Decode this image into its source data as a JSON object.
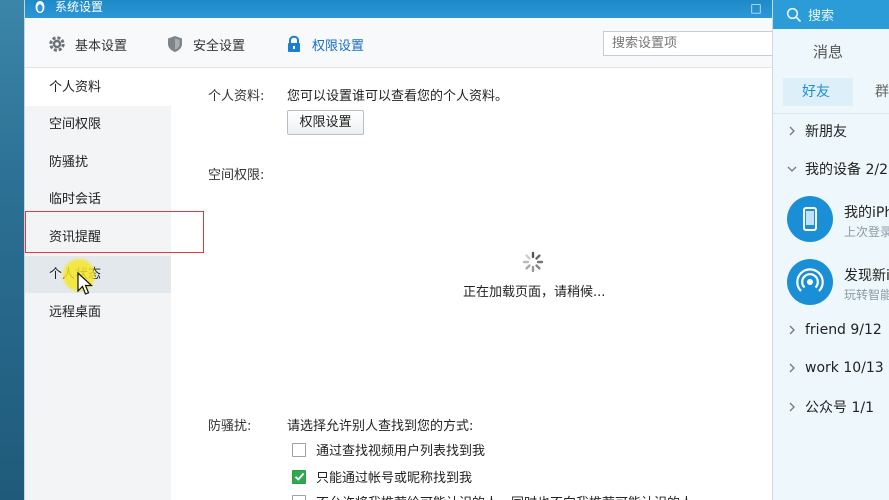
{
  "window": {
    "title": "系统设置",
    "close_glyph": "□"
  },
  "toolbar": {
    "items": [
      {
        "label": "基本设置",
        "icon": "gear-icon"
      },
      {
        "label": "安全设置",
        "icon": "shield-icon"
      },
      {
        "label": "权限设置",
        "icon": "lock-icon",
        "active": true
      }
    ],
    "search_placeholder": "搜索设置项"
  },
  "sidebar": {
    "items": [
      {
        "label": "个人资料"
      },
      {
        "label": "空间权限"
      },
      {
        "label": "防骚扰"
      },
      {
        "label": "临时会话"
      },
      {
        "label": "资讯提醒"
      },
      {
        "label": "个人状态"
      },
      {
        "label": "远程桌面"
      }
    ]
  },
  "content": {
    "profile_label": "个人资料:",
    "profile_text": "您可以设置谁可以查看您的个人资料。",
    "perm_button": "权限设置",
    "space_label": "空间权限:",
    "loading_text": "正在加载页面，请稍候...",
    "harass_label": "防骚扰:",
    "harass_text": "请选择允许别人查找到您的方式:",
    "options": [
      {
        "label": "通过查找视频用户列表找到我",
        "checked": false
      },
      {
        "label": "只能通过帐号或昵称找到我",
        "checked": true
      },
      {
        "label": "不允许将我推荐给可能认识的人，同时也不向我推荐可能认识的人",
        "checked": false
      }
    ]
  },
  "qq": {
    "search_label": "搜索",
    "tab_messages": "消息",
    "tab_friends": "好友",
    "tab_groups": "群",
    "groups": [
      {
        "label": "新朋友"
      },
      {
        "label": "我的设备 2/2"
      }
    ],
    "devices": [
      {
        "name": "我的iPh",
        "sub": "上次登录"
      },
      {
        "name": "发现新i",
        "sub": "玩转智能"
      }
    ],
    "more_groups": [
      {
        "label": "friend 9/12"
      },
      {
        "label": "work 10/13"
      },
      {
        "label": "公众号 1/1"
      }
    ]
  },
  "colors": {
    "accent": "#1a6fc2",
    "titlebar": "#2b97d6",
    "highlight_box": "#e5393d",
    "checkbox_checked": "#33a853"
  }
}
